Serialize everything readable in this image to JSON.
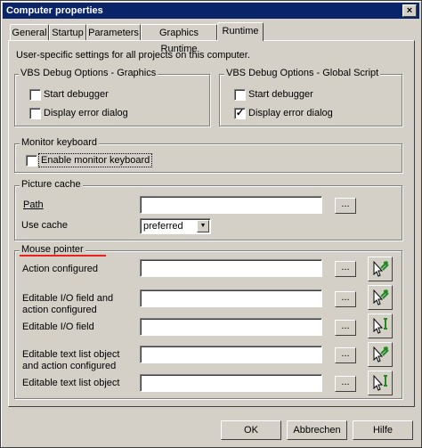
{
  "window": {
    "title": "Computer properties",
    "close_glyph": "×"
  },
  "tabs": [
    {
      "label": "General"
    },
    {
      "label": "Startup"
    },
    {
      "label": "Parameters"
    },
    {
      "label": "Graphics Runtime"
    },
    {
      "label": "Runtime",
      "active": true
    }
  ],
  "intro": "User-specific settings for all projects on this computer.",
  "vbs_graphics": {
    "title": "VBS Debug Options - Graphics",
    "start_debugger": {
      "label": "Start debugger",
      "checked": false
    },
    "display_error_dialog": {
      "label": "Display error dialog",
      "checked": false
    }
  },
  "vbs_global": {
    "title": "VBS Debug Options - Global Script",
    "start_debugger": {
      "label": "Start debugger",
      "checked": false
    },
    "display_error_dialog": {
      "label": "Display error dialog",
      "checked": true,
      "check_glyph": "✓"
    }
  },
  "monitor_keyboard": {
    "title": "Monitor keyboard",
    "enable": {
      "label": "Enable monitor keyboard",
      "checked": false
    }
  },
  "picture_cache": {
    "title": "Picture cache",
    "path_label": "Path",
    "path_value": "",
    "use_cache_label": "Use cache",
    "use_cache_value": "preferred",
    "browse_label": "...",
    "dropdown_glyph": "▼"
  },
  "mouse_pointer": {
    "title": "Mouse pointer",
    "accent_color": "#e8231f",
    "rows": [
      {
        "label": "Action configured",
        "value": "",
        "browse": "...",
        "icon": "cursor-action-icon"
      },
      {
        "label": "Editable I/O field and action configured",
        "value": "",
        "browse": "...",
        "icon": "cursor-action-icon"
      },
      {
        "label": "Editable I/O field",
        "value": "",
        "browse": "...",
        "icon": "cursor-ibeam-icon"
      },
      {
        "label": "Editable text list object and action configured",
        "value": "",
        "browse": "...",
        "icon": "cursor-action-icon"
      },
      {
        "label": "Editable text list object",
        "value": "",
        "browse": "...",
        "icon": "cursor-ibeam-icon"
      }
    ]
  },
  "buttons": {
    "ok": "OK",
    "cancel": "Abbrechen",
    "help": "Hilfe"
  },
  "colors": {
    "titlebar": "#0a246a",
    "face": "#d4d0c8",
    "icon_green": "#1f8a1f"
  }
}
